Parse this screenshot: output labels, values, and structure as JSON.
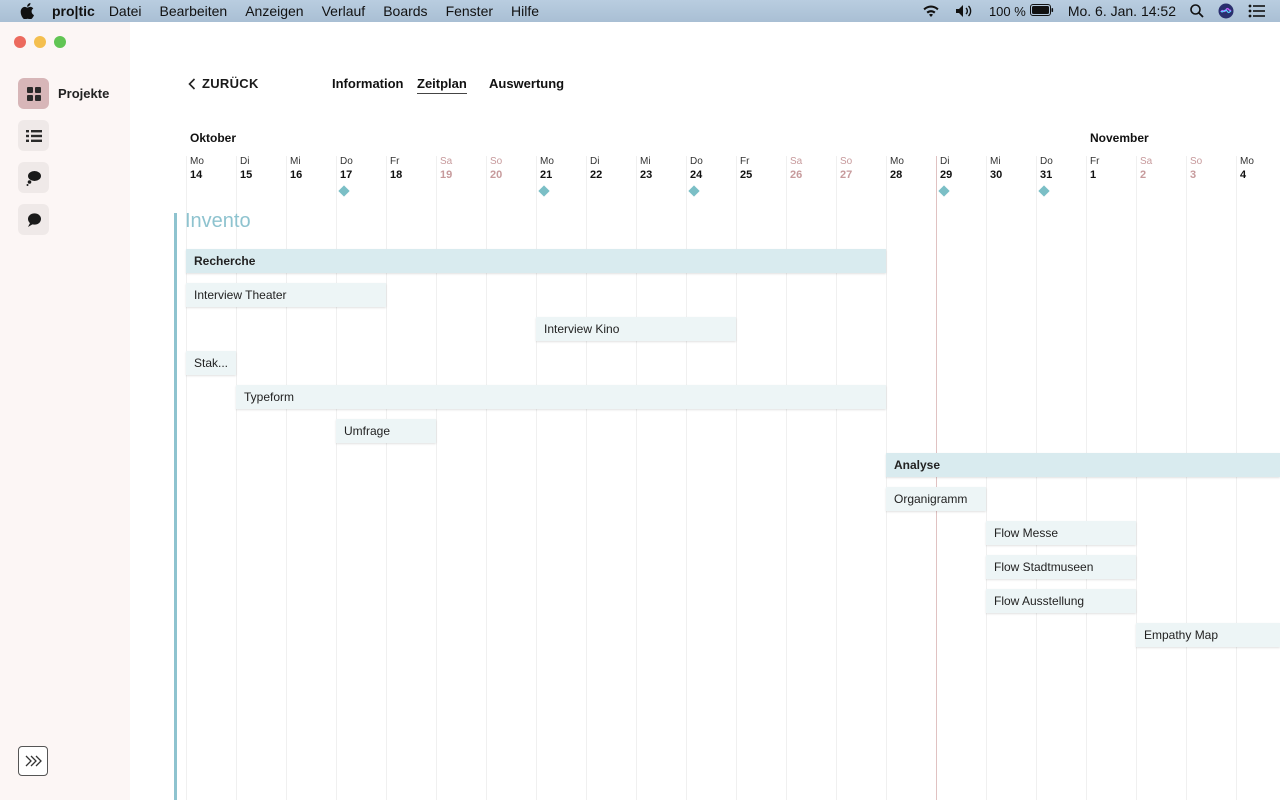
{
  "menubar": {
    "app_name": "pro|tic",
    "menus": [
      "Datei",
      "Bearbeiten",
      "Anzeigen",
      "Verlauf",
      "Boards",
      "Fenster",
      "Hilfe"
    ],
    "battery": "100 %",
    "clock": "Mo. 6. Jan. 14:52"
  },
  "sidebar": {
    "projects_label": "Projekte"
  },
  "header": {
    "back_label": "ZURÜCK",
    "tabs": [
      "Information",
      "Zeitplan",
      "Auswertung"
    ],
    "active_tab": "Zeitplan"
  },
  "timeline": {
    "months": [
      {
        "label": "Oktober",
        "start_index": 0
      },
      {
        "label": "November",
        "start_index": 18
      }
    ],
    "days": [
      {
        "wd": "Mo",
        "dn": "14",
        "weekend": false
      },
      {
        "wd": "Di",
        "dn": "15",
        "weekend": false
      },
      {
        "wd": "Mi",
        "dn": "16",
        "weekend": false
      },
      {
        "wd": "Do",
        "dn": "17",
        "weekend": false
      },
      {
        "wd": "Fr",
        "dn": "18",
        "weekend": false
      },
      {
        "wd": "Sa",
        "dn": "19",
        "weekend": true
      },
      {
        "wd": "So",
        "dn": "20",
        "weekend": true
      },
      {
        "wd": "Mo",
        "dn": "21",
        "weekend": false
      },
      {
        "wd": "Di",
        "dn": "22",
        "weekend": false
      },
      {
        "wd": "Mi",
        "dn": "23",
        "weekend": false
      },
      {
        "wd": "Do",
        "dn": "24",
        "weekend": false
      },
      {
        "wd": "Fr",
        "dn": "25",
        "weekend": false
      },
      {
        "wd": "Sa",
        "dn": "26",
        "weekend": true
      },
      {
        "wd": "So",
        "dn": "27",
        "weekend": true
      },
      {
        "wd": "Mo",
        "dn": "28",
        "weekend": false
      },
      {
        "wd": "Di",
        "dn": "29",
        "weekend": false
      },
      {
        "wd": "Mi",
        "dn": "30",
        "weekend": false
      },
      {
        "wd": "Do",
        "dn": "31",
        "weekend": false
      },
      {
        "wd": "Fr",
        "dn": "1",
        "weekend": false
      },
      {
        "wd": "Sa",
        "dn": "2",
        "weekend": true
      },
      {
        "wd": "So",
        "dn": "3",
        "weekend": true
      },
      {
        "wd": "Mo",
        "dn": "4",
        "weekend": false
      }
    ],
    "milestone_day_indices": [
      3,
      7,
      10,
      15,
      17
    ],
    "today_index": 15,
    "project_name": "Invento",
    "tasks": [
      {
        "label": "Recherche",
        "start": 0,
        "end": 14,
        "group": true
      },
      {
        "label": "Interview Theater",
        "start": 0,
        "end": 4,
        "group": false
      },
      {
        "label": "Interview Kino",
        "start": 7,
        "end": 11,
        "group": false
      },
      {
        "label": "Stak...",
        "start": 0,
        "end": 1,
        "group": false
      },
      {
        "label": "Typeform",
        "start": 1,
        "end": 14,
        "group": false
      },
      {
        "label": "Umfrage",
        "start": 3,
        "end": 5,
        "group": false
      },
      {
        "label": "Analyse",
        "start": 14,
        "end": 22,
        "group": true
      },
      {
        "label": "Organigramm",
        "start": 14,
        "end": 16,
        "group": false
      },
      {
        "label": "Flow Messe",
        "start": 16,
        "end": 19,
        "group": false
      },
      {
        "label": "Flow Stadtmuseen",
        "start": 16,
        "end": 19,
        "group": false
      },
      {
        "label": "Flow Ausstellung",
        "start": 16,
        "end": 19,
        "group": false
      },
      {
        "label": "Empathy Map",
        "start": 19,
        "end": 22,
        "group": false
      }
    ]
  },
  "colors": {
    "accent": "#8ec3cf",
    "weekend": "#c79a9c",
    "sidebar_active": "#d7b6b8"
  }
}
